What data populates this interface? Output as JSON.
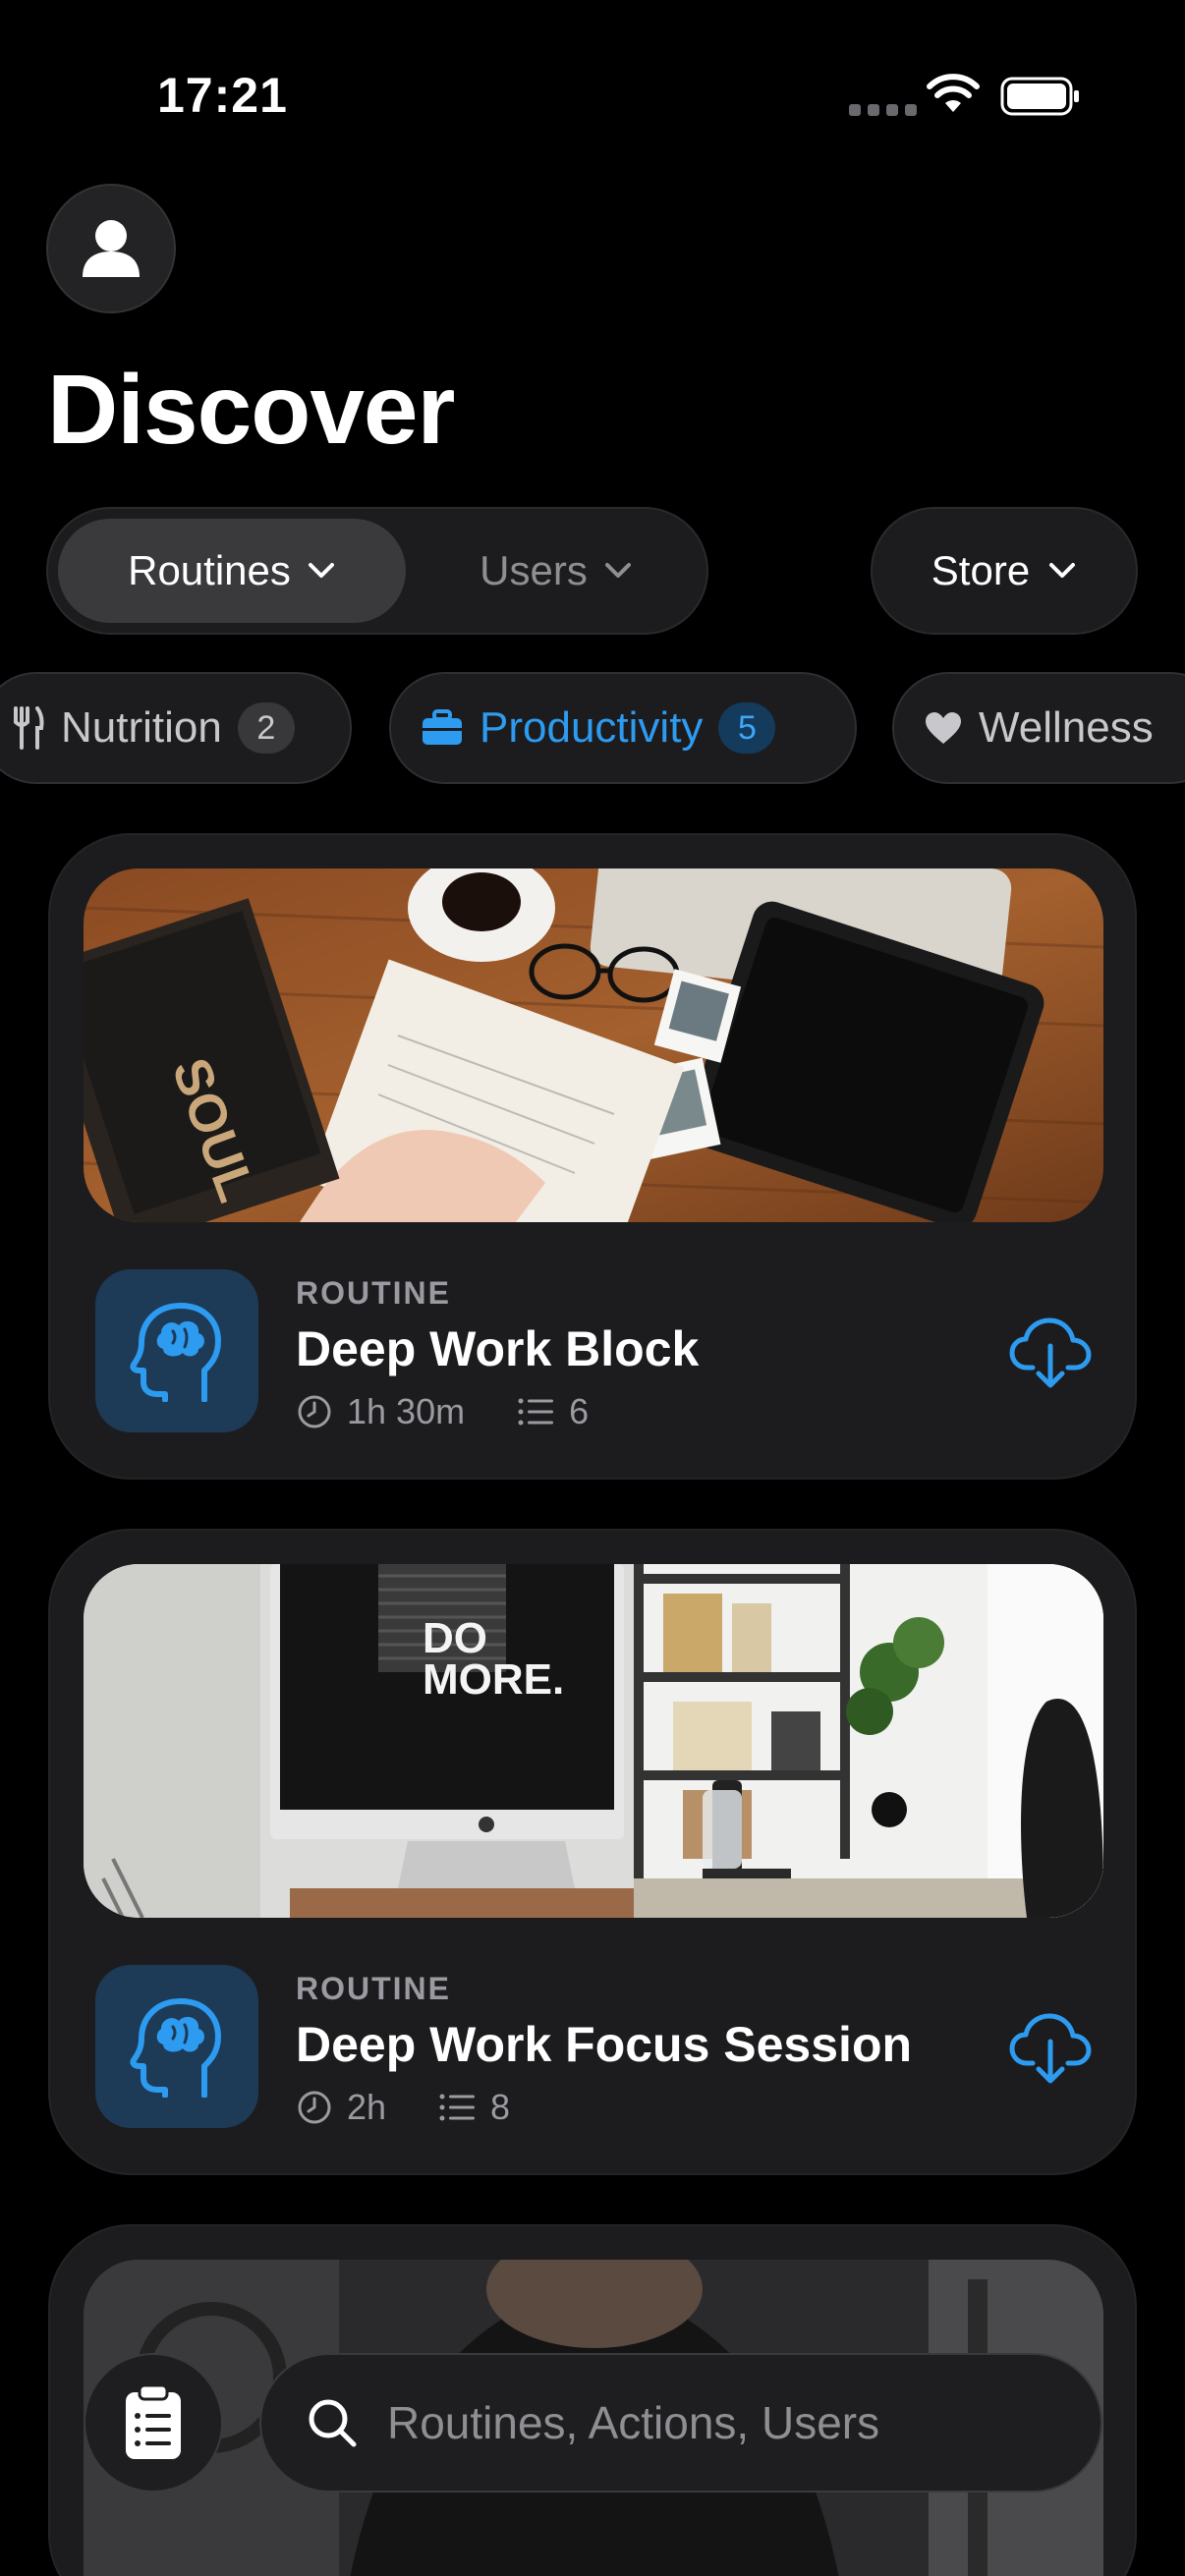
{
  "status_bar": {
    "time": "17:21"
  },
  "header": {
    "title": "Discover",
    "avatar_icon": "person-icon"
  },
  "segment": {
    "active": "Routines",
    "inactive": "Users"
  },
  "store": {
    "label": "Store"
  },
  "categories": [
    {
      "label": "Nutrition",
      "count": "2",
      "icon": "fork-knife-icon"
    },
    {
      "label": "Productivity",
      "count": "5",
      "icon": "briefcase-icon",
      "selected": true
    },
    {
      "label": "Wellness",
      "icon": "heart-icon"
    }
  ],
  "cards": [
    {
      "kicker": "ROUTINE",
      "title": "Deep Work Block",
      "duration": "1h 30m",
      "steps": "6",
      "icon": "brain-head-icon"
    },
    {
      "kicker": "ROUTINE",
      "title": "Deep Work Focus Session",
      "duration": "2h",
      "steps": "8",
      "icon": "brain-head-icon"
    }
  ],
  "search": {
    "placeholder": "Routines, Actions, Users"
  },
  "colors": {
    "accent": "#2d9bf0",
    "background": "#000000",
    "card": "#1c1c1e"
  }
}
